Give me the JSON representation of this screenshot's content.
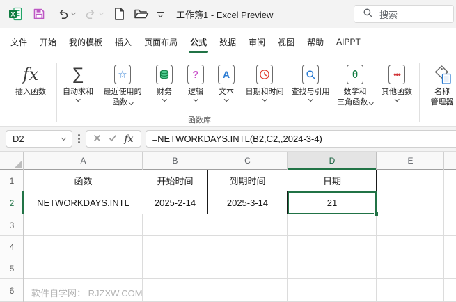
{
  "title_bar": {
    "document_title": "工作簿1  -  Excel Preview",
    "search_label": "搜索",
    "quick_access_icons": [
      "excel-logo",
      "save",
      "undo",
      "redo",
      "new-document",
      "open-folder",
      "customize-quick-access"
    ]
  },
  "menu_tabs": [
    {
      "label": "文件"
    },
    {
      "label": "开始"
    },
    {
      "label": "我的模板"
    },
    {
      "label": "插入"
    },
    {
      "label": "页面布局"
    },
    {
      "label": "公式",
      "active": true
    },
    {
      "label": "数据"
    },
    {
      "label": "审阅"
    },
    {
      "label": "视图"
    },
    {
      "label": "帮助"
    },
    {
      "label": "AIPPT"
    }
  ],
  "ribbon": {
    "group_label": "函数库",
    "buttons": [
      {
        "icon": "fx",
        "glyph": "fx",
        "label1": "插入函数"
      },
      {
        "icon": "sigma",
        "glyph": "∑",
        "label1": "自动求和",
        "dropdown": true
      },
      {
        "icon": "star",
        "glyph": "☆",
        "label1": "最近使用的",
        "label2": "函数",
        "dropdown": true
      },
      {
        "icon": "coins",
        "label1": "财务",
        "dropdown": true
      },
      {
        "icon": "question-mark",
        "glyph": "?",
        "label1": "逻辑",
        "dropdown": true
      },
      {
        "icon": "letter-a",
        "glyph": "A",
        "label1": "文本",
        "dropdown": true
      },
      {
        "icon": "clock",
        "label1": "日期和时间",
        "dropdown": true
      },
      {
        "icon": "magnifier",
        "label1": "查找与引用",
        "dropdown": true
      },
      {
        "icon": "theta",
        "glyph": "θ",
        "label1": "数学和",
        "label2": "三角函数",
        "dropdown": true
      },
      {
        "icon": "dots",
        "glyph": "•••",
        "label1": "其他函数",
        "dropdown": true
      },
      {
        "icon": "name-tag",
        "label1": "名称",
        "label2": "管理器"
      }
    ]
  },
  "formula_bar": {
    "cell_reference": "D2",
    "formula": "=NETWORKDAYS.INTL(B2,C2,,2024-3-4)"
  },
  "sheet": {
    "column_headers": [
      "A",
      "B",
      "C",
      "D",
      "E"
    ],
    "active_column": "D",
    "active_cell": "D2",
    "row_numbers": [
      "1",
      "2",
      "3",
      "4",
      "5",
      "6"
    ],
    "rows": [
      [
        "函数",
        "开始时间",
        "到期时间",
        "日期"
      ],
      [
        "NETWORKDAYS.INTL",
        "2025-2-14",
        "2025-3-14",
        "21"
      ],
      [],
      [],
      [],
      []
    ]
  },
  "watermark": "软件自学网： RJZXW.COM",
  "colors": {
    "accent_green": "#217346",
    "save_icon_magenta": "#bd57c4"
  }
}
